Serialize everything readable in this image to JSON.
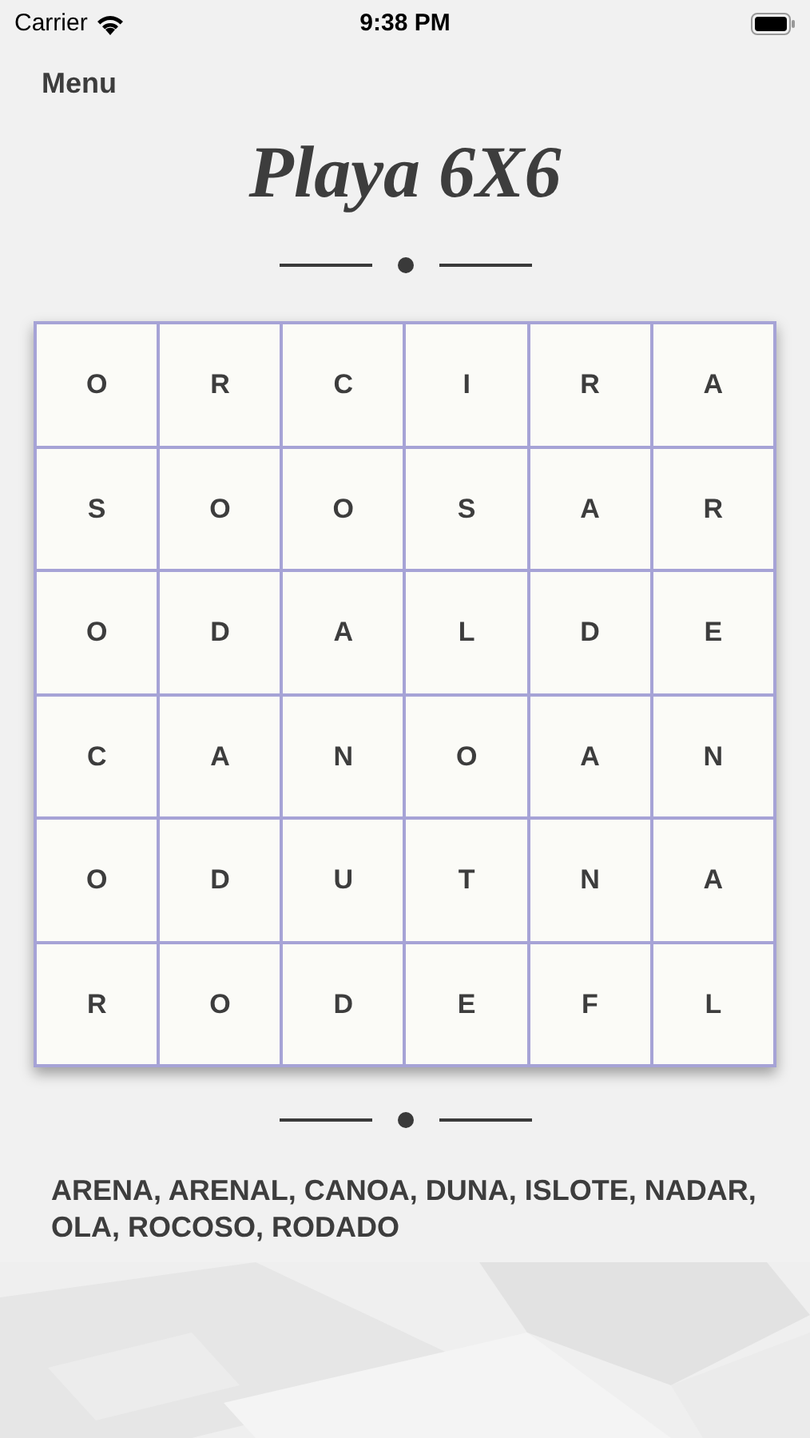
{
  "status_bar": {
    "carrier": "Carrier",
    "time": "9:38 PM"
  },
  "nav": {
    "menu": "Menu"
  },
  "title": "Playa 6X6",
  "grid": [
    [
      "O",
      "R",
      "C",
      "I",
      "R",
      "A"
    ],
    [
      "S",
      "O",
      "O",
      "S",
      "A",
      "R"
    ],
    [
      "O",
      "D",
      "A",
      "L",
      "D",
      "E"
    ],
    [
      "C",
      "A",
      "N",
      "O",
      "A",
      "N"
    ],
    [
      "O",
      "D",
      "U",
      "T",
      "N",
      "A"
    ],
    [
      "R",
      "O",
      "D",
      "E",
      "F",
      "L"
    ]
  ],
  "words": "ARENA, ARENAL, CANOA, DUNA, ISLOTE, NADAR, OLA, ROCOSO, RODADO"
}
